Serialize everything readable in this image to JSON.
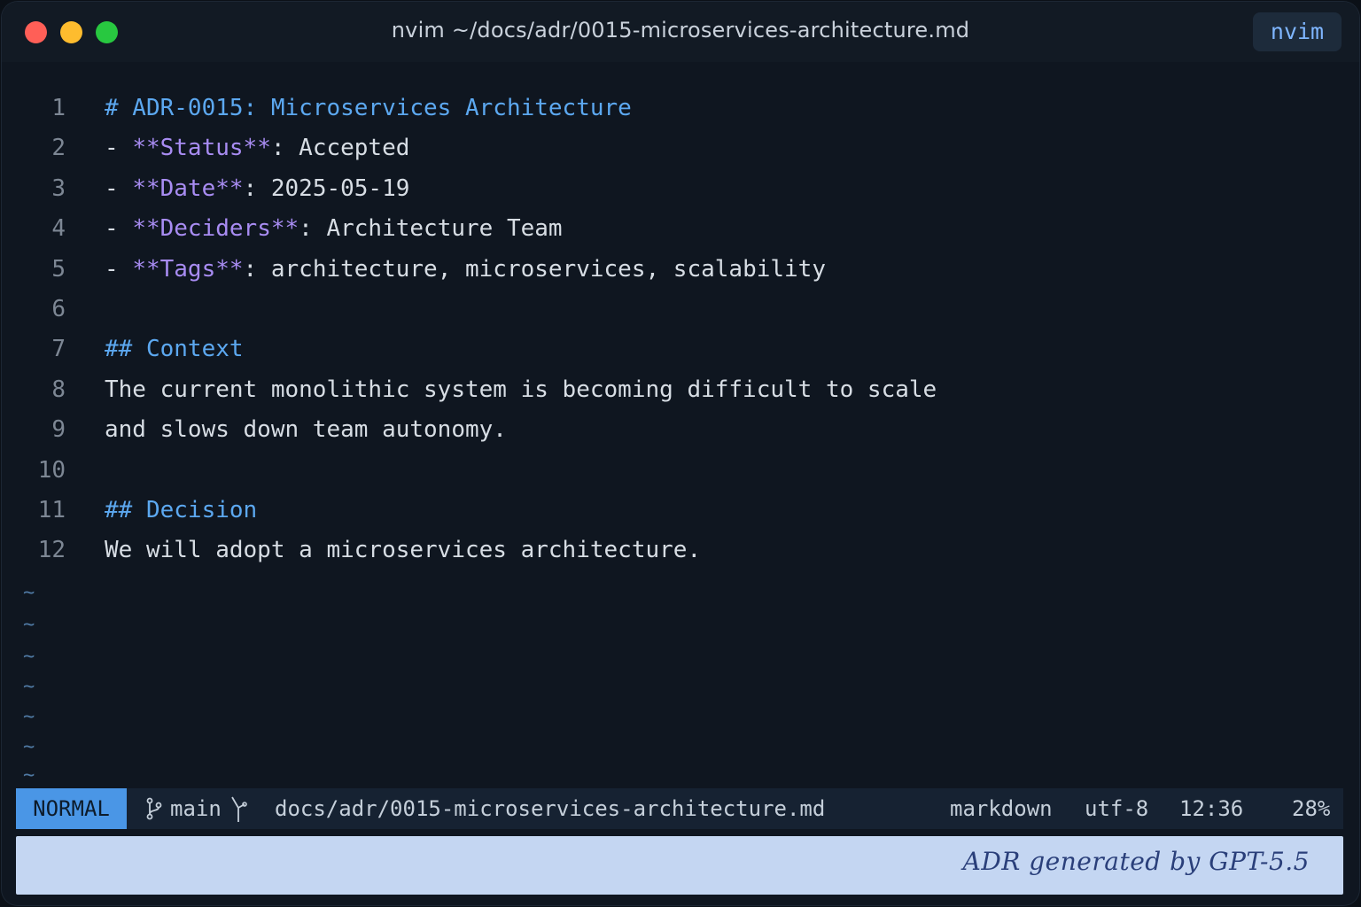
{
  "window": {
    "title": "nvim  ~/docs/adr/0015-microservices-architecture.md",
    "app_badge": "nvim"
  },
  "editor": {
    "lines": [
      {
        "num": "1",
        "parts": [
          {
            "t": "# ADR-0015: Microservices Architecture",
            "c": "h"
          }
        ]
      },
      {
        "num": "2",
        "parts": [
          {
            "t": "- ",
            "c": "bullet"
          },
          {
            "t": "**Status**",
            "c": "bold"
          },
          {
            "t": ": Accepted",
            "c": ""
          }
        ]
      },
      {
        "num": "3",
        "parts": [
          {
            "t": "- ",
            "c": "bullet"
          },
          {
            "t": "**Date**",
            "c": "bold"
          },
          {
            "t": ": 2025-05-19",
            "c": ""
          }
        ]
      },
      {
        "num": "4",
        "parts": [
          {
            "t": "- ",
            "c": "bullet"
          },
          {
            "t": "**Deciders**",
            "c": "bold"
          },
          {
            "t": ": Architecture Team",
            "c": ""
          }
        ]
      },
      {
        "num": "5",
        "parts": [
          {
            "t": "- ",
            "c": "bullet"
          },
          {
            "t": "**Tags**",
            "c": "bold"
          },
          {
            "t": ": architecture, microservices, scalability",
            "c": ""
          }
        ]
      },
      {
        "num": "6",
        "parts": []
      },
      {
        "num": "7",
        "parts": [
          {
            "t": "## Context",
            "c": "h"
          }
        ]
      },
      {
        "num": "8",
        "parts": [
          {
            "t": "The current monolithic system is becoming difficult to scale",
            "c": ""
          }
        ]
      },
      {
        "num": "9",
        "parts": [
          {
            "t": "and slows down team autonomy.",
            "c": ""
          }
        ]
      },
      {
        "num": "10",
        "parts": []
      },
      {
        "num": "11",
        "parts": [
          {
            "t": "## Decision",
            "c": "h"
          }
        ]
      },
      {
        "num": "12",
        "parts": [
          {
            "t": "We will adopt a microservices architecture.",
            "c": ""
          }
        ]
      }
    ],
    "tilde": "~"
  },
  "statusline": {
    "mode": "NORMAL",
    "branch": "main",
    "path": "docs/adr/0015-microservices-architecture.md",
    "filetype": "markdown",
    "encoding": "utf-8",
    "position": "12:36",
    "percent": "28%"
  },
  "cmdline": {
    "signature": "ADR generated by GPT-5.5"
  },
  "colors": {
    "heading": "#5ca8f0",
    "bold_marker": "#a88cf2",
    "mode_bg": "#4a96e6",
    "background": "#0f1620"
  }
}
